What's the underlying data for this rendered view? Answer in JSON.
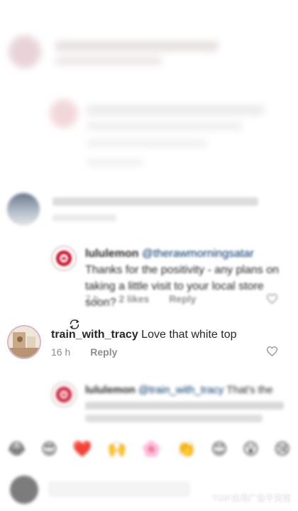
{
  "comments": [
    {
      "id": "c1",
      "username": "",
      "text": "",
      "time": "",
      "likes": "",
      "reply": ""
    },
    {
      "id": "c2",
      "username": "lululemon",
      "mention": "@therawmorningsatar",
      "text": "Thanks for the positivity - any plans on taking a little visit to your local store soon?",
      "time": "7 h",
      "likes": "2 likes",
      "reply": "Reply"
    },
    {
      "id": "c3",
      "username": "train_with_tracy",
      "text": "Love that white top",
      "time": "16 h",
      "reply": "Reply"
    },
    {
      "id": "c4",
      "username": "lululemon",
      "mention": "@train_with_tracy",
      "text": "That's the ...",
      "time": "",
      "reply": ""
    }
  ],
  "emoji_bar": {
    "items": [
      "😂",
      "😍",
      "❤️",
      "🙌",
      "🌸",
      "👏",
      "😊",
      "😮",
      "😢"
    ]
  },
  "watermark": {
    "text": "TGIF出海广告干货馆"
  },
  "colors": {
    "brand_red": "#c9112b",
    "muted_text": "#8e8e8e",
    "body_text": "#262626"
  }
}
